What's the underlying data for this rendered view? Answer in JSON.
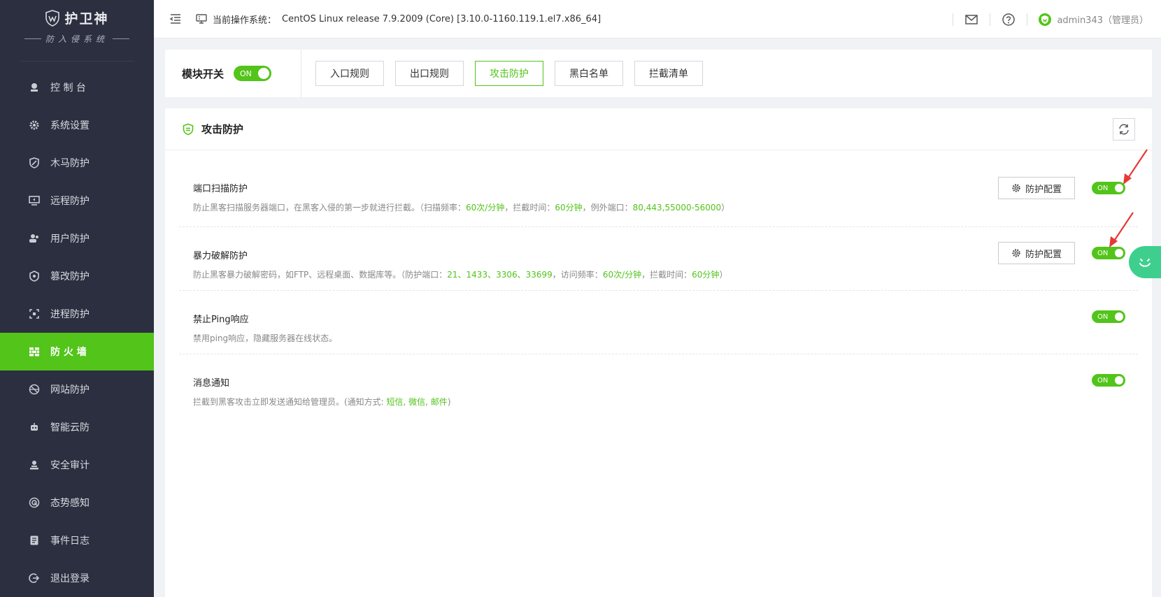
{
  "logo": {
    "title": "护卫神",
    "subtitle": "防入侵系统"
  },
  "sidebar": {
    "items": [
      {
        "label": "控 制 台",
        "icon": "dashboard-icon"
      },
      {
        "label": "系统设置",
        "icon": "gear-icon"
      },
      {
        "label": "木马防护",
        "icon": "trojan-shield-icon"
      },
      {
        "label": "远程防护",
        "icon": "remote-desktop-icon"
      },
      {
        "label": "用户防护",
        "icon": "users-icon"
      },
      {
        "label": "篡改防护",
        "icon": "tamper-icon"
      },
      {
        "label": "进程防护",
        "icon": "process-icon"
      },
      {
        "label": "防 火 墙",
        "icon": "firewall-icon",
        "active": true
      },
      {
        "label": "网站防护",
        "icon": "website-icon"
      },
      {
        "label": "智能云防",
        "icon": "robot-icon"
      },
      {
        "label": "安全审计",
        "icon": "audit-icon"
      },
      {
        "label": "态势感知",
        "icon": "radar-icon"
      },
      {
        "label": "事件日志",
        "icon": "log-icon"
      },
      {
        "label": "退出登录",
        "icon": "logout-icon"
      }
    ]
  },
  "header": {
    "os_label": "当前操作系统：",
    "os_value": "CentOS Linux release 7.9.2009 (Core) [3.10.0-1160.119.1.el7.x86_64]",
    "user": "admin343（管理员）"
  },
  "module": {
    "label": "模块开关",
    "switch": "ON",
    "tabs": [
      {
        "label": "入口规则"
      },
      {
        "label": "出口规则"
      },
      {
        "label": "攻击防护",
        "active": true
      },
      {
        "label": "黑白名单"
      },
      {
        "label": "拦截清单"
      }
    ]
  },
  "panel": {
    "title": "攻击防护",
    "rules": [
      {
        "title": "端口扫描防护",
        "desc_parts": [
          {
            "t": "防止黑客扫描服务器端口，在黑客入侵的第一步就进行拦截。（扫描频率：",
            "hl": false
          },
          {
            "t": "60次/分钟",
            "hl": true
          },
          {
            "t": "，拦截时间：",
            "hl": false
          },
          {
            "t": "60分钟",
            "hl": true
          },
          {
            "t": "，例外端口：",
            "hl": false
          },
          {
            "t": "80,443,55000-56000",
            "hl": true
          },
          {
            "t": "）",
            "hl": false
          }
        ],
        "config_label": "防护配置",
        "has_config": true,
        "switch": "ON"
      },
      {
        "title": "暴力破解防护",
        "desc_parts": [
          {
            "t": "防止黑客暴力破解密码，如FTP、远程桌面、数据库等。（防护端口：",
            "hl": false
          },
          {
            "t": "21、1433、3306、33699",
            "hl": true
          },
          {
            "t": "，访问频率：",
            "hl": false
          },
          {
            "t": "60次/分钟",
            "hl": true
          },
          {
            "t": "，拦截时间：",
            "hl": false
          },
          {
            "t": "60分钟",
            "hl": true
          },
          {
            "t": "）",
            "hl": false
          }
        ],
        "config_label": "防护配置",
        "has_config": true,
        "switch": "ON"
      },
      {
        "title": "禁止Ping响应",
        "desc_parts": [
          {
            "t": "禁用ping响应，隐藏服务器在线状态。",
            "hl": false
          }
        ],
        "has_config": false,
        "switch": "ON"
      },
      {
        "title": "消息通知",
        "desc_parts": [
          {
            "t": "拦截到黑客攻击立即发送通知给管理员。(通知方式: ",
            "hl": false
          },
          {
            "t": "短信, 微信, 邮件",
            "hl": true
          },
          {
            "t": ")",
            "hl": false
          }
        ],
        "has_config": false,
        "switch": "ON"
      }
    ]
  },
  "colors": {
    "accent": "#52c41a",
    "sidebar": "#2b2f3f",
    "arrow": "#e53935"
  }
}
